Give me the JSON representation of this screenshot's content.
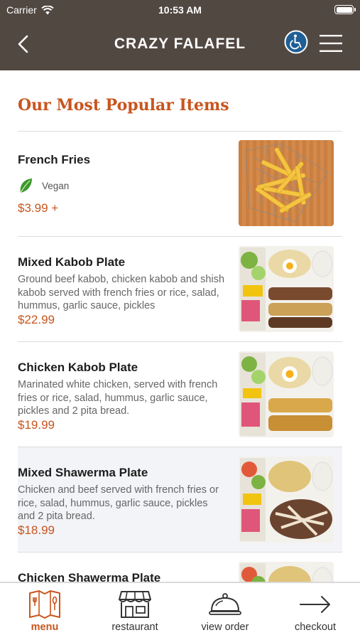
{
  "status_bar": {
    "carrier": "Carrier",
    "time": "10:53 AM"
  },
  "nav": {
    "title": "CRAZY FALAFEL"
  },
  "section_title": "Our Most Popular Items",
  "items": [
    {
      "name": "French Fries",
      "tag": "Vegan",
      "description": "",
      "price": "$3.99 +"
    },
    {
      "name": "Mixed Kabob Plate",
      "description": "Ground beef kabob, chicken kabob and shish kabob served with french fries or rice, salad, hummus, garlic sauce, pickles",
      "price": "$22.99"
    },
    {
      "name": "Chicken Kabob Plate",
      "description": "Marinated white chicken, served with french fries or rice, salad, hummus, garlic sauce, pickles and 2 pita bread.",
      "price": "$19.99"
    },
    {
      "name": "Mixed Shawerma Plate",
      "description": "Chicken and beef served with french fries or rice, salad, hummus, garlic sauce, pickles and 2 pita bread.",
      "price": "$18.99"
    },
    {
      "name": "Chicken Shawerma Plate",
      "description": "",
      "price": ""
    }
  ],
  "tabs": [
    {
      "label": "menu",
      "icon": "menu-book-icon",
      "active": true
    },
    {
      "label": "restaurant",
      "icon": "storefront-icon",
      "active": false
    },
    {
      "label": "view order",
      "icon": "cloche-icon",
      "active": false
    },
    {
      "label": "checkout",
      "icon": "arrow-right-icon",
      "active": false
    }
  ],
  "colors": {
    "header_bg": "#524842",
    "accent": "#c8551e",
    "highlight_row": "#f2f4f7"
  }
}
